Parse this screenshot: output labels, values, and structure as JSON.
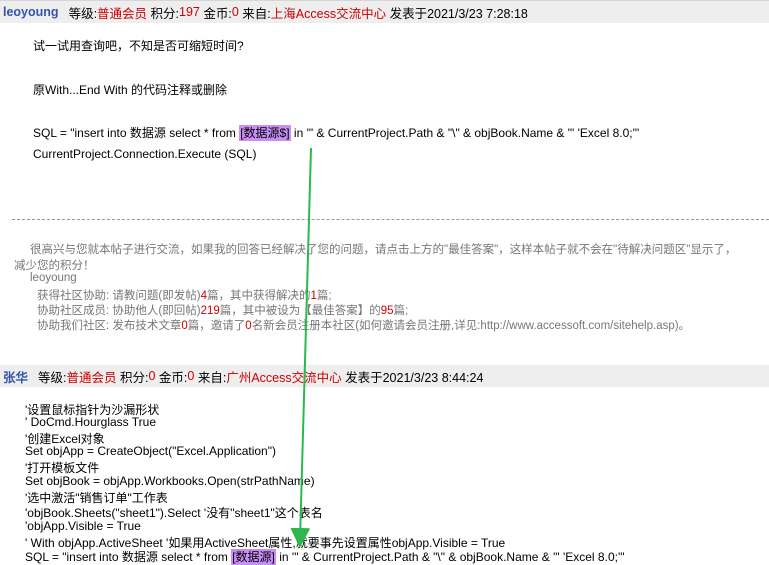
{
  "post1": {
    "author": "leoyoung",
    "grade_label": "等级:",
    "grade": "普通会员",
    "points_label": "积分:",
    "points": "197",
    "gold_label": "金币:",
    "gold": "0",
    "from_label": "来自:",
    "from": "上海Access交流中心",
    "posted": "发表于2021/3/23 7:28:18",
    "line1": "试一试用查询吧，不知是否可缩短时间?",
    "line2": "原With...End With 的代码注释或删除",
    "sql_pre": "SQL = \"insert into 数据源 select * from ",
    "sql_hl": "[数据源$]",
    "sql_post": " in '\" & CurrentProject.Path & \"\\\" & objBook.Name & \"' 'Excel 8.0;'\"",
    "exec": "CurrentProject.Connection.Execute (SQL)"
  },
  "signature": {
    "thanks": "很高兴与您就本帖子进行交流，如果我的回答已经解决了您的问题，请点击上方的\"最佳答案\"，这样本帖子就不会在\"待解决问题区\"显示了，",
    "thanks2": "减少您的积分！",
    "name": "leoyoung",
    "s1_pre": "获得社区协助: 请教问题(即发帖)",
    "s1_n1": "4",
    "s1_mid": "篇，其中获得解决的",
    "s1_n2": "1",
    "s1_post": "篇;",
    "s2_pre": "协助社区成员: 协助他人(即回帖)",
    "s2_n1": "219",
    "s2_mid": "篇，其中被设为【最佳答案】的",
    "s2_n2": "95",
    "s2_post": "篇;",
    "s3_pre": "协助我们社区: 发布技术文章",
    "s3_n1": "0",
    "s3_mid": "篇，邀请了",
    "s3_n2": "0",
    "s3_post": "名新会员注册本社区(如何邀请会员注册,详见:http://www.accessoft.com/sitehelp.asp)。"
  },
  "post2": {
    "author": "张华",
    "grade_label": "等级:",
    "grade": "普通会员",
    "points_label": "积分:",
    "points": "0",
    "gold_label": "金币:",
    "gold": "0",
    "from_label": "来自:",
    "from": "广州Access交流中心",
    "posted": "发表于2021/3/23 8:44:24",
    "lines": [
      "'设置鼠标指针为沙漏形状",
      "'     DoCmd.Hourglass True",
      "'创建Excel对象",
      "Set objApp = CreateObject(\"Excel.Application\")",
      "'打开模板文件",
      "Set objBook = objApp.Workbooks.Open(strPathName)",
      "'选中激活\"销售订单\"工作表",
      "'objBook.Sheets(\"sheet1\").Select    '没有\"sheet1\"这个表名",
      "'objApp.Visible = True",
      "' With objApp.ActiveSheet    '如果用ActiveSheet属性,就要事先设置属性objApp.Visible = True"
    ],
    "sql_pre": "SQL = \"insert into 数据源 select * from ",
    "sql_hl": "[数据源]",
    "sql_post": " in '\" & CurrentProject.Path & \"\\\" & objBook.Name & \"' 'Excel 8.0;'\""
  },
  "colors": {
    "highlight": "#c98ef5",
    "arrow": "#2db84b",
    "author": "#3355aa",
    "accent_red": "#cc0000"
  }
}
